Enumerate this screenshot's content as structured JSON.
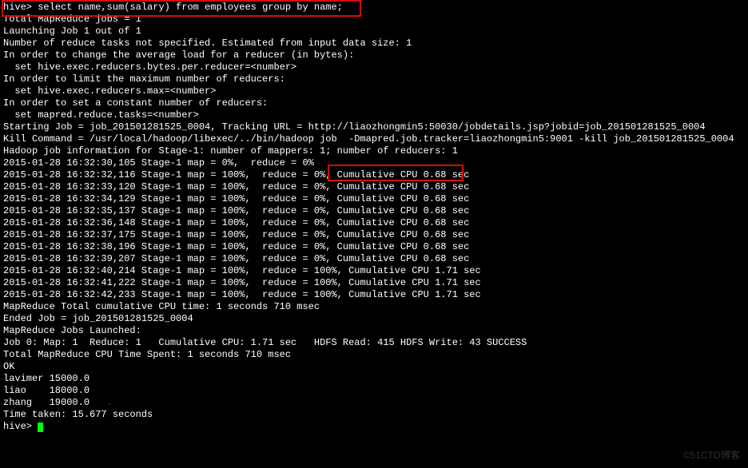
{
  "prompt": "hive>",
  "command": "select name,sum(salary) from employees group by name;",
  "log": [
    "Total MapReduce jobs = 1",
    "Launching Job 1 out of 1",
    "Number of reduce tasks not specified. Estimated from input data size: 1",
    "In order to change the average load for a reducer (in bytes):",
    "  set hive.exec.reducers.bytes.per.reducer=<number>",
    "In order to limit the maximum number of reducers:",
    "  set hive.exec.reducers.max=<number>",
    "In order to set a constant number of reducers:",
    "  set mapred.reduce.tasks=<number>",
    "Starting Job = job_201501281525_0004, Tracking URL = http://liaozhongmin5:50030/jobdetails.jsp?jobid=job_201501281525_0004",
    "Kill Command = /usr/local/hadoop/libexec/../bin/hadoop job  -Dmapred.job.tracker=liaozhongmin5:9001 -kill job_201501281525_0004",
    "Hadoop job information for Stage-1: number of mappers: 1; number of reducers: 1",
    "2015-01-28 16:32:30,105 Stage-1 map = 0%,  reduce = 0%",
    "2015-01-28 16:32:32,116 Stage-1 map = 100%,  reduce = 0%, Cumulative CPU 0.68 sec",
    "2015-01-28 16:32:33,120 Stage-1 map = 100%,  reduce = 0%, Cumulative CPU 0.68 sec",
    "2015-01-28 16:32:34,129 Stage-1 map = 100%,  reduce = 0%, Cumulative CPU 0.68 sec",
    "2015-01-28 16:32:35,137 Stage-1 map = 100%,  reduce = 0%, Cumulative CPU 0.68 sec",
    "2015-01-28 16:32:36,148 Stage-1 map = 100%,  reduce = 0%, Cumulative CPU 0.68 sec",
    "2015-01-28 16:32:37,175 Stage-1 map = 100%,  reduce = 0%, Cumulative CPU 0.68 sec",
    "2015-01-28 16:32:38,196 Stage-1 map = 100%,  reduce = 0%, Cumulative CPU 0.68 sec",
    "2015-01-28 16:32:39,207 Stage-1 map = 100%,  reduce = 0%, Cumulative CPU 0.68 sec",
    "2015-01-28 16:32:40,214 Stage-1 map = 100%,  reduce = 100%, Cumulative CPU 1.71 sec",
    "2015-01-28 16:32:41,222 Stage-1 map = 100%,  reduce = 100%, Cumulative CPU 1.71 sec",
    "2015-01-28 16:32:42,233 Stage-1 map = 100%,  reduce = 100%, Cumulative CPU 1.71 sec",
    "MapReduce Total cumulative CPU time: 1 seconds 710 msec",
    "Ended Job = job_201501281525_0004",
    "MapReduce Jobs Launched:",
    "Job 0: Map: 1  Reduce: 1   Cumulative CPU: 1.71 sec   HDFS Read: 415 HDFS Write: 43 SUCCESS",
    "Total MapReduce CPU Time Spent: 1 seconds 710 msec",
    "OK"
  ],
  "results": [
    "lavimer 15000.0",
    "liao    18000.0",
    "zhang   19000.0"
  ],
  "time_taken": "Time taken: 15.677 seconds",
  "trailing_prompt": "hive>",
  "watermark": "©51CTO博客"
}
